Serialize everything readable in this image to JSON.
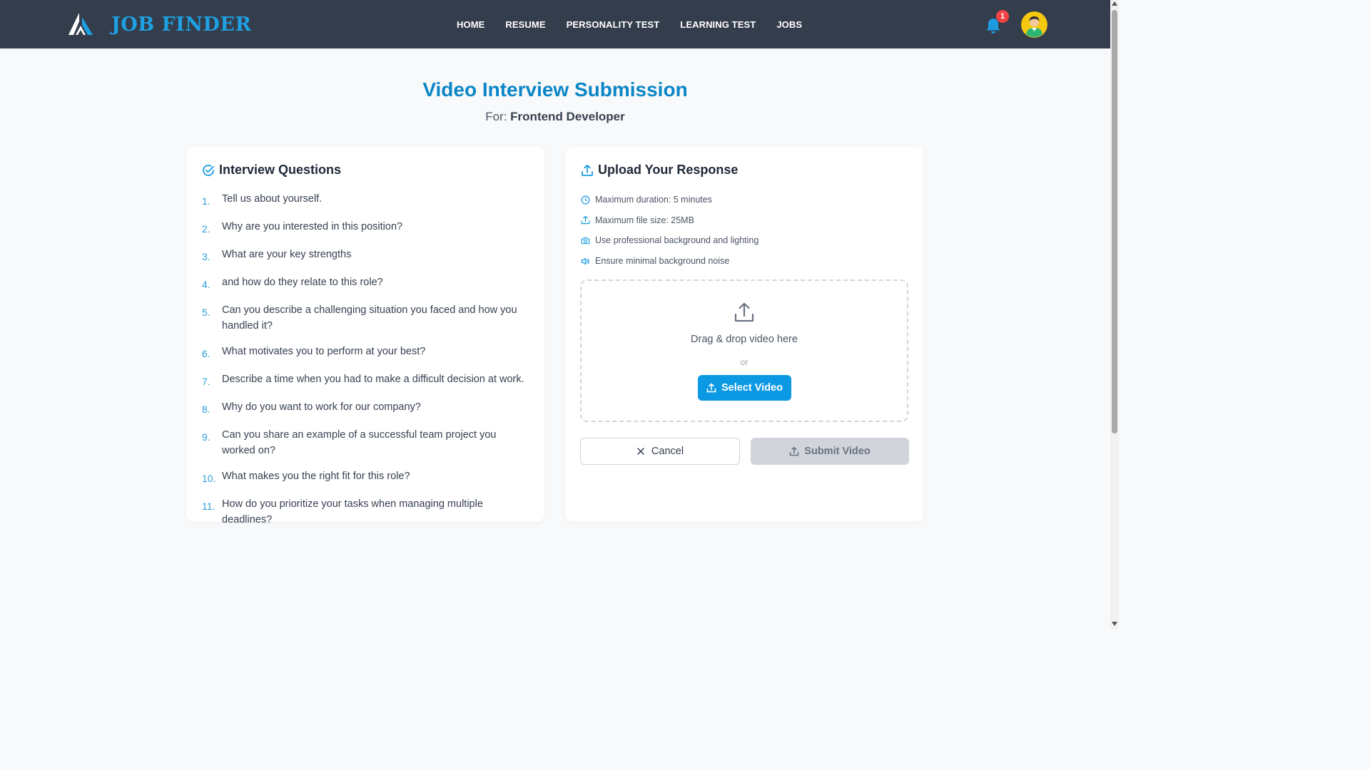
{
  "header": {
    "brand_name": "JOB FINDER",
    "nav": [
      "HOME",
      "RESUME",
      "PERSONALITY TEST",
      "LEARNING TEST",
      "JOBS"
    ],
    "notification_count": "1"
  },
  "page": {
    "title": "Video Interview Submission",
    "subtitle_prefix": "For: ",
    "role": "Frontend Developer"
  },
  "questions_card": {
    "title": "Interview Questions",
    "questions": [
      {
        "num": "1.",
        "text": "Tell us about yourself."
      },
      {
        "num": "2.",
        "text": "Why are you interested in this position?"
      },
      {
        "num": "3.",
        "text": "What are your key strengths"
      },
      {
        "num": "4.",
        "text": "and how do they relate to this role?"
      },
      {
        "num": "5.",
        "text": "Can you describe a challenging situation you faced and how you handled it?"
      },
      {
        "num": "6.",
        "text": "What motivates you to perform at your best?"
      },
      {
        "num": "7.",
        "text": "Describe a time when you had to make a difficult decision at work."
      },
      {
        "num": "8.",
        "text": "Why do you want to work for our company?"
      },
      {
        "num": "9.",
        "text": "Can you share an example of a successful team project you worked on?"
      },
      {
        "num": "10.",
        "text": "What makes you the right fit for this role?"
      },
      {
        "num": "11.",
        "text": "How do you prioritize your tasks when managing multiple deadlines?"
      }
    ]
  },
  "upload_card": {
    "title": "Upload Your Response",
    "requirements": [
      {
        "icon": "clock-icon",
        "text": "Maximum duration: 5 minutes"
      },
      {
        "icon": "upload-icon",
        "text": "Maximum file size: 25MB"
      },
      {
        "icon": "camera-icon",
        "text": "Use professional background and lighting"
      },
      {
        "icon": "volume-icon",
        "text": "Ensure minimal background noise"
      }
    ],
    "dropzone_text": "Drag & drop video here",
    "dropzone_or": "or",
    "select_label": "Select Video",
    "cancel_label": "Cancel",
    "submit_label": "Submit Video"
  },
  "colors": {
    "accent": "#0c99e4",
    "title": "#0a86c7",
    "navbar": "#343d4c",
    "badge": "#ef4444"
  }
}
